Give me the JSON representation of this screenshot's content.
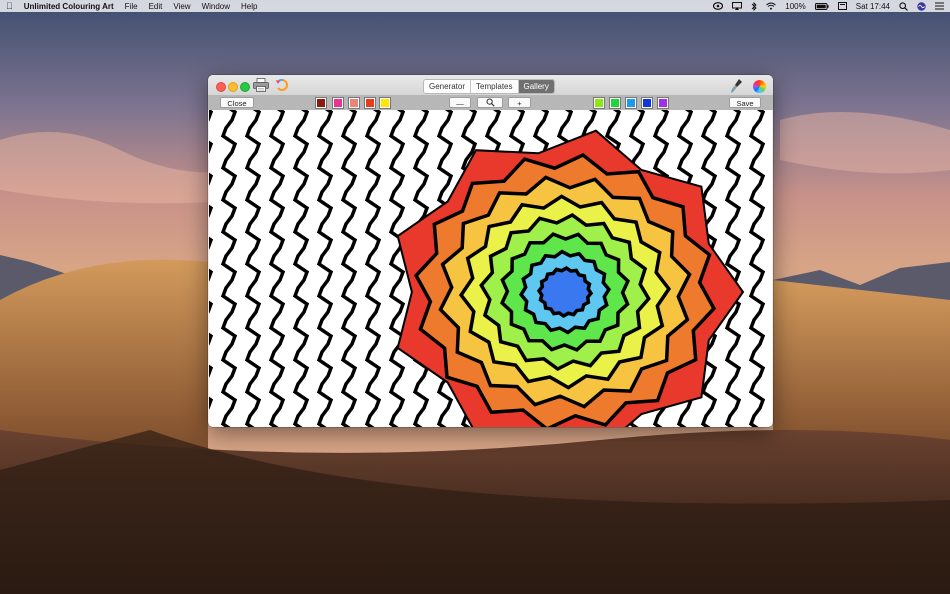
{
  "menubar": {
    "app_name": "Unlimited Colouring Art",
    "menus": [
      "File",
      "Edit",
      "View",
      "Window",
      "Help"
    ],
    "battery": "100%",
    "clock": "Sat 17:44"
  },
  "window": {
    "tabs": [
      {
        "label": "Generator",
        "active": false
      },
      {
        "label": "Templates",
        "active": false
      },
      {
        "label": "Gallery",
        "active": true
      }
    ]
  },
  "toolbar": {
    "close_label": "Close",
    "save_label": "Save",
    "zoom_out_label": "—",
    "zoom_in_label": "+",
    "left_swatches": [
      "#8b1a10",
      "#e8358f",
      "#e8857a",
      "#e83a1c",
      "#ffe500"
    ],
    "right_swatches": [
      "#8aea10",
      "#1fd63a",
      "#1e9be8",
      "#1035e0",
      "#a030e8"
    ]
  },
  "artwork": {
    "ring_colors": [
      "#e8392c",
      "#ee7a2e",
      "#f7c442",
      "#eaf24a",
      "#9ff04a",
      "#5ee64a",
      "#5ec8f0",
      "#3a78f0"
    ]
  }
}
